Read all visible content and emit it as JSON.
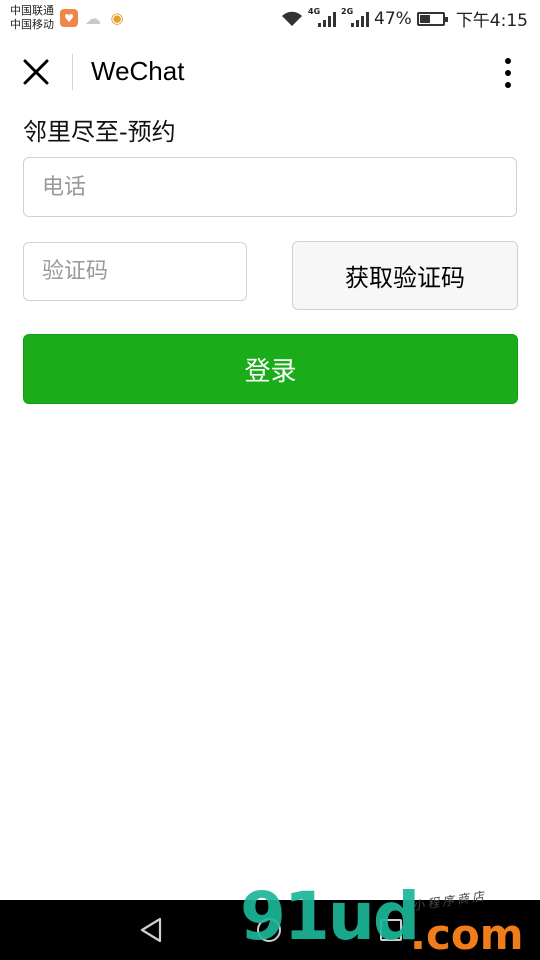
{
  "status_bar": {
    "carrier_1": "中国联通",
    "carrier_2": "中国移动",
    "net_1": "4G",
    "net_2": "2G",
    "battery": "47%",
    "battery_level": 0.47,
    "time": "下午4:15"
  },
  "title_bar": {
    "title": "WeChat"
  },
  "page": {
    "heading": "邻里尽至-预约",
    "phone_placeholder": "电话",
    "code_placeholder": "验证码",
    "get_code_label": "获取验证码",
    "login_label": "登录"
  },
  "watermark": {
    "main": "91ud",
    "dot": ".com",
    "sub": "小程序商店"
  },
  "colors": {
    "primary_green": "#1aad19",
    "watermark_teal": "#1db79a",
    "watermark_orange": "#f07d1a"
  },
  "icons": {
    "close": "close-icon",
    "more": "more-vertical-icon",
    "back": "back-triangle-icon",
    "home": "home-circle-icon",
    "recent": "recent-square-icon"
  }
}
